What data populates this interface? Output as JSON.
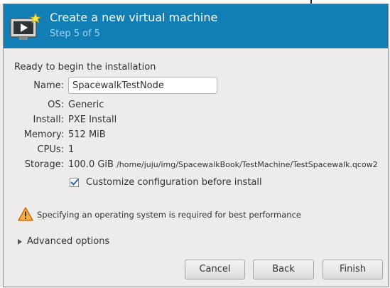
{
  "header": {
    "title": "Create a new virtual machine",
    "step": "Step 5 of 5"
  },
  "summary": {
    "heading": "Ready to begin the installation",
    "name_label": "Name:",
    "name_value": "SpacewalkTestNode",
    "rows": [
      {
        "label": "OS:",
        "value": "Generic"
      },
      {
        "label": "Install:",
        "value": "PXE Install"
      },
      {
        "label": "Memory:",
        "value": "512 MiB"
      },
      {
        "label": "CPUs:",
        "value": "1"
      },
      {
        "label": "Storage:",
        "value": "100.0 GiB",
        "extra": "/home/juju/img/SpacewalkBook/TestMachine/TestSpacewalk.qcow2"
      }
    ]
  },
  "customize": {
    "label": "Customize configuration before install",
    "checked": true
  },
  "warning": {
    "text": "Specifying an operating system is required for best performance",
    "color": "#f57900"
  },
  "advanced": {
    "label": "Advanced options",
    "expanded": false
  },
  "buttons": {
    "cancel": "Cancel",
    "back": "Back",
    "finish": "Finish"
  },
  "colors": {
    "header_bg": "#117fb5",
    "subtitle": "#9fd6ff",
    "window_bg": "#edeceb"
  }
}
